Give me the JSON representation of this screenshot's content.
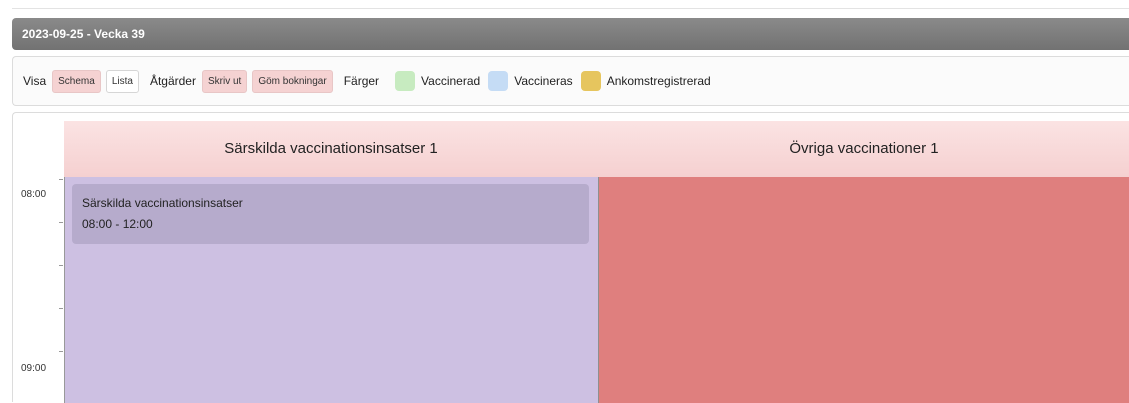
{
  "header": {
    "date_title": "2023-09-25 - Vecka 39"
  },
  "toolbar": {
    "visa_label": "Visa",
    "schema_label": "Schema",
    "lista_label": "Lista",
    "atgarder_label": "Åtgärder",
    "skriv_ut_label": "Skriv ut",
    "gom_bokningar_label": "Göm bokningar",
    "farger_label": "Färger",
    "legend": [
      {
        "label": "Vaccinerad",
        "color": "#c7ebc0"
      },
      {
        "label": "Vaccineras",
        "color": "#c5dcf5"
      },
      {
        "label": "Ankomstregistrerad",
        "color": "#e6c55e"
      }
    ]
  },
  "calendar": {
    "columns": [
      {
        "title": "Särskilda vaccinationsinsatser 1",
        "color": "#cdc0e2"
      },
      {
        "title": "Övriga vaccinationer 1",
        "color": "#df7f7e"
      }
    ],
    "times": [
      "08:00",
      "09:00"
    ],
    "event": {
      "title": "Särskilda vaccinationsinsatser",
      "time": "08:00 - 12:00"
    }
  }
}
